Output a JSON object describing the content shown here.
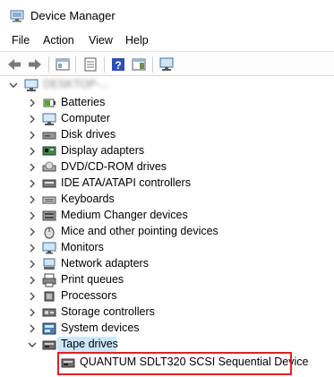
{
  "window": {
    "title": "Device Manager"
  },
  "menu": {
    "items": [
      "File",
      "Action",
      "View",
      "Help"
    ]
  },
  "toolbar": {
    "buttons": [
      "back-icon",
      "forward-icon",
      "properties-pane-icon",
      "console-tree-icon",
      "help-icon",
      "action-pane-icon",
      "monitor-icon"
    ]
  },
  "tree": {
    "root_label": "DESKTOP-...",
    "categories": [
      {
        "label": "Batteries",
        "icon": "battery-icon"
      },
      {
        "label": "Computer",
        "icon": "computer-icon"
      },
      {
        "label": "Disk drives",
        "icon": "disk-drive-icon"
      },
      {
        "label": "Display adapters",
        "icon": "display-adapter-icon"
      },
      {
        "label": "DVD/CD-ROM drives",
        "icon": "dvd-drive-icon"
      },
      {
        "label": "IDE ATA/ATAPI controllers",
        "icon": "ide-controller-icon"
      },
      {
        "label": "Keyboards",
        "icon": "keyboard-icon"
      },
      {
        "label": "Medium Changer devices",
        "icon": "medium-changer-icon"
      },
      {
        "label": "Mice and other pointing devices",
        "icon": "mouse-icon"
      },
      {
        "label": "Monitors",
        "icon": "monitor-icon"
      },
      {
        "label": "Network adapters",
        "icon": "network-adapter-icon"
      },
      {
        "label": "Print queues",
        "icon": "printer-icon"
      },
      {
        "label": "Processors",
        "icon": "processor-icon"
      },
      {
        "label": "Storage controllers",
        "icon": "storage-controller-icon"
      },
      {
        "label": "System devices",
        "icon": "system-device-icon"
      },
      {
        "label": "Tape drives",
        "icon": "tape-drive-icon"
      }
    ],
    "tape_device": "QUANTUM SDLT320 SCSI Sequential Device"
  },
  "colors": {
    "selection": "#cce8ff",
    "highlight_border": "#e02020"
  }
}
